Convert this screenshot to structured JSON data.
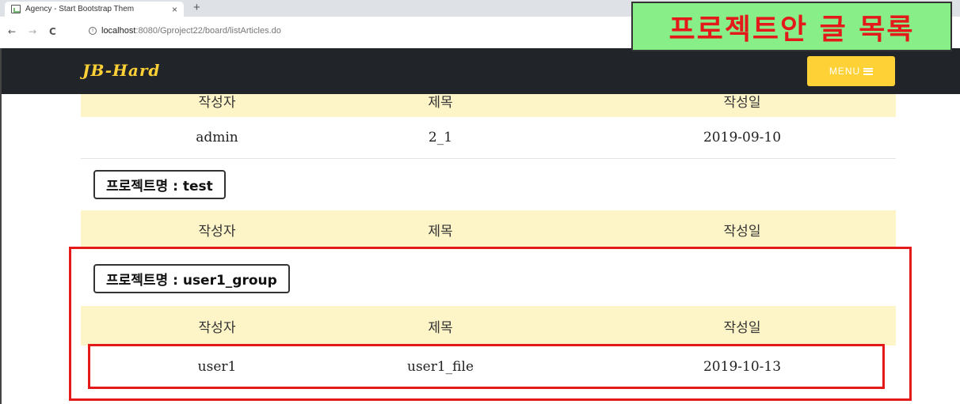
{
  "browser": {
    "tab_title": "Agency - Start Bootstrap Them",
    "tab_close": "×",
    "new_tab": "+",
    "back": "←",
    "forward": "→",
    "reload": "C",
    "info": "i",
    "url_host": "localhost",
    "url_rest": ":8080/Gproject22/board/listArticles.do"
  },
  "annotation": {
    "label": "프로젝트안 글 목록",
    "color": "#e41a1a",
    "label_bg": "#88ee88"
  },
  "site": {
    "brand": "JB-Hard",
    "menu_label": "MENU",
    "accent": "#fed136",
    "nav_bg": "#212529"
  },
  "columns": {
    "author": "작성자",
    "title": "제목",
    "date": "작성일"
  },
  "projects": [
    {
      "label": "",
      "header": {
        "author": "작성자",
        "title": "제목",
        "date": "작성일"
      },
      "rows": [
        {
          "author": "admin",
          "title": "2_1",
          "date": "2019-09-10"
        }
      ]
    },
    {
      "label": "프로젝트명 : test",
      "header": {
        "author": "작성자",
        "title": "제목",
        "date": "작성일"
      },
      "rows": []
    },
    {
      "label": "프로젝트명 : user1_group",
      "header": {
        "author": "작성자",
        "title": "제목",
        "date": "작성일"
      },
      "rows": [
        {
          "author": "user1",
          "title": "user1_file",
          "date": "2019-10-13"
        }
      ]
    }
  ]
}
